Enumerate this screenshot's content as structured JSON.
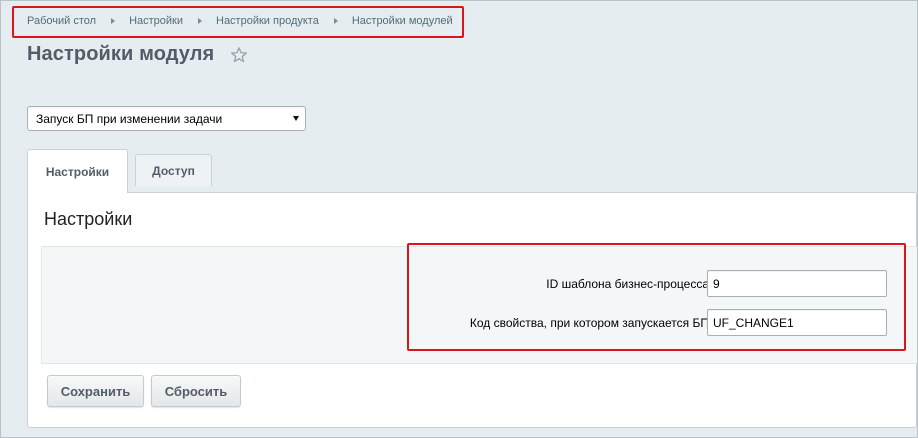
{
  "breadcrumb": [
    "Рабочий стол",
    "Настройки",
    "Настройки продукта",
    "Настройки модулей"
  ],
  "page_title": "Настройки модуля",
  "module_select": {
    "value": "Запуск БП при изменении задачи"
  },
  "tabs": [
    {
      "label": "Настройки",
      "active": true
    },
    {
      "label": "Доступ",
      "active": false
    }
  ],
  "section_title": "Настройки",
  "fields": [
    {
      "label": "ID шаблона бизнес-процесса",
      "value": "9"
    },
    {
      "label": "Код свойства, при котором запускается БП",
      "value": "UF_CHANGE1"
    }
  ],
  "buttons": {
    "save": "Сохранить",
    "reset": "Сбросить"
  },
  "colors": {
    "highlight": "#d9161c",
    "background": "#e6edf0",
    "title": "#535c69"
  },
  "icons": {
    "favorite": "star-icon",
    "breadcrumb_separator": "triangle-right-icon",
    "dropdown": "chevron-down-icon"
  }
}
